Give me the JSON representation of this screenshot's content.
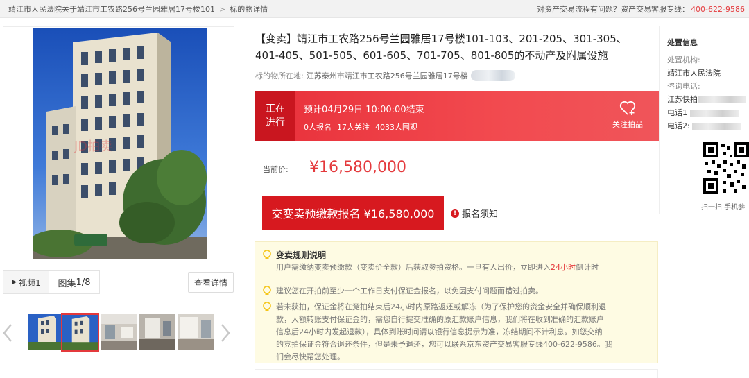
{
  "breadcrumb": {
    "items": [
      "靖江市人民法院关于靖江市工农路256号兰园雅居17号楼101",
      "标的物详情"
    ],
    "separator": ">"
  },
  "service": {
    "question": "对资产交易流程有问题？资产交易客服专线：",
    "hotline": "400-622-9586"
  },
  "gallery": {
    "video_label": "视频1",
    "images_label": "图集",
    "images_index": "1/8",
    "detail_button": "查看详情",
    "main_image_watermark": "JD拍卖",
    "thumb_count": 5,
    "active_thumb": 1
  },
  "listing": {
    "title": "【变卖】靖江市工农路256号兰园雅居17号楼101-103、201-205、301-305、401-405、501-505、601-605、701-705、801-805的不动产及附属设施",
    "location_label": "标的物所在地:",
    "location_value": "江苏泰州市靖江市工农路256号兰园雅居17号楼"
  },
  "status": {
    "label_line1": "正在",
    "label_line2": "进行",
    "deadline": "预计04月29日 10:00:00结束",
    "signups": "0人报名",
    "followers": "17人关注",
    "viewers": "4033人围观",
    "follow_label": "关注拍品",
    "color": "#e8303a"
  },
  "price": {
    "label": "当前价:",
    "value": "¥16,580,000",
    "color": "#e4393c"
  },
  "actions": {
    "signup_button": "交变卖预缴款报名 ¥16,580,000",
    "notice_link": "报名须知",
    "button_color": "#d7191f"
  },
  "rules": {
    "title": "变卖规则说明",
    "intro_before": "用户需缴纳变卖预缴款（变卖价全款）后获取参拍资格。一旦有人出价，立即进入",
    "intro_highlight": "24小时",
    "intro_after": "倒计时",
    "tip1": "建议您在开拍前至少一个工作日支付保证金报名，以免因支付问题而错过拍卖。",
    "tip2_line1": "若未获拍，保证金将在竞拍结束后24小时内原路返还或解冻（为了保护您的资金安全并确保顺利退",
    "tip2_line2": "款，大额转账支付保证金的，需您自行提交准确的原汇款账户信息，我们将在收到准确的汇款账户",
    "tip2_line3": "信息后24小时内发起退款），具体到账时间请以银行信息提示为准，冻结期间不计利息。如您交纳",
    "tip2_line4": "的竞拍保证金符合退还条件，但是未予退还，您可以联系京东资产交易客服专线400-622-9586。我",
    "tip2_line5": "们会尽快帮您处理。"
  },
  "disposal": {
    "title": "处置信息",
    "org_label": "处置机构:",
    "org_value": "靖江市人民法院",
    "phone_label": "咨询电话:",
    "phone_value": "江苏快拍",
    "phone1_label": "电话1",
    "phone2_label": "电话2:",
    "qr_caption": "扫一扫 手机参"
  }
}
